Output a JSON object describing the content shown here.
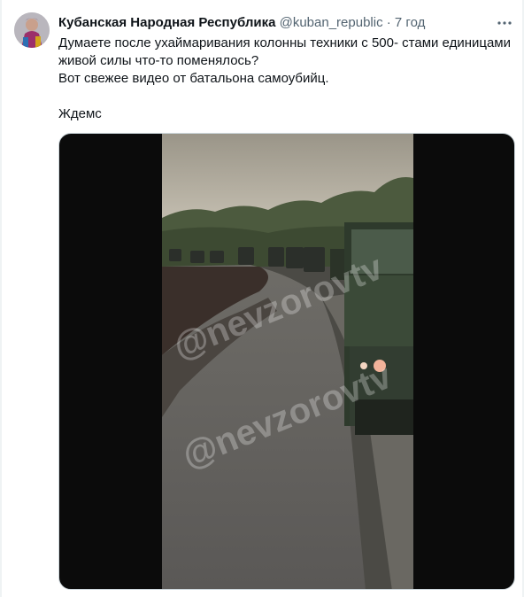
{
  "tweet": {
    "author_name": "Кубанская Народная Республика",
    "author_handle": "@kuban_republic",
    "separator": "·",
    "time": "7 год",
    "lines": [
      "Думаете после ухаймаривания колонны техники с 500- стами единицами живой силы что-то поменялось?",
      "Вот свежее видео от батальона самоубийц.",
      "Ждемс"
    ]
  },
  "media": {
    "watermark": "@nevzorovtv"
  },
  "icons": {
    "more": "more-horizontal-icon"
  }
}
